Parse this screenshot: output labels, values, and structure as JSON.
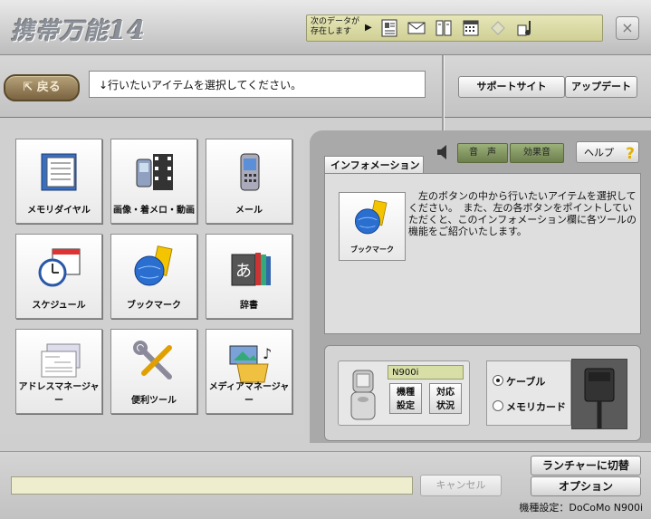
{
  "title": {
    "logo_text": "携帯万能",
    "logo_num": "14",
    "close": "×"
  },
  "databar": {
    "text_line1": "次のデータが",
    "text_line2": "存在します",
    "arrow": "▶"
  },
  "nav": {
    "back_label": "戻る",
    "instruction": "↓行いたいアイテムを選択してください。"
  },
  "top_buttons": {
    "support": "サポートサイト",
    "update": "アップデート"
  },
  "tiles": [
    {
      "label": "メモリダイヤル"
    },
    {
      "label": "画像・着メロ・動画"
    },
    {
      "label": "メール"
    },
    {
      "label": "スケジュール"
    },
    {
      "label": "ブックマーク"
    },
    {
      "label": "辞書"
    },
    {
      "label": "アドレスマネージャー"
    },
    {
      "label": "便利ツール"
    },
    {
      "label": "メディアマネージャー"
    }
  ],
  "info": {
    "tab_label": "インフォメーション",
    "tile_label": "ブックマーク",
    "text": "　左のボタンの中から行いたいアイテムを選択してください。　また、左の各ボタンをポイントしていただくと、このインフォメーション欄に各ツールの機能をご紹介いたします。"
  },
  "sound": {
    "voice": "音　声",
    "effects": "効果音"
  },
  "help": {
    "label": "ヘルプ",
    "icon": "?"
  },
  "device": {
    "model": "N900i",
    "btn_settings_l1": "機種",
    "btn_settings_l2": "設定",
    "btn_status_l1": "対応",
    "btn_status_l2": "状況",
    "radio_cable": "ケーブル",
    "radio_card": "メモリカード",
    "selected": "ケーブル"
  },
  "bottom": {
    "cancel": "キャンセル",
    "launcher": "ランチャーに切替",
    "options": "オプション",
    "status": "機種設定：DoCoMo N900i"
  },
  "colors": {
    "back_button": "#7a6340",
    "sound_buttons": "#6c7f4d",
    "databar": "#cfcf95"
  }
}
